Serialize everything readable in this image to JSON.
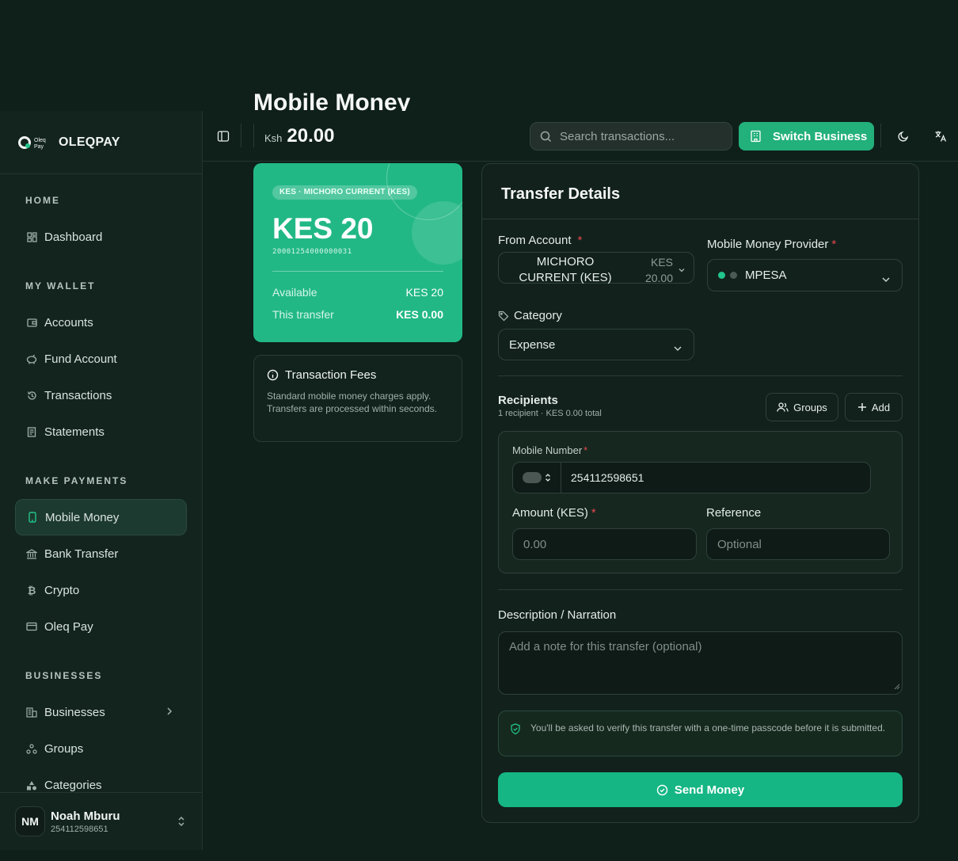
{
  "app": {
    "name": "OLEQPAY",
    "logo_text": "Oleq Pay"
  },
  "page": {
    "title": "Mobile Money"
  },
  "topbar": {
    "currency": "Ksh",
    "balance": "20.00",
    "search_placeholder": "Search transactions...",
    "switch_business_label": "Switch Business"
  },
  "sidebar": {
    "sections": {
      "home": "HOME",
      "wallet": "MY WALLET",
      "payments": "MAKE PAYMENTS",
      "businesses": "BUSINESSES"
    },
    "items": {
      "dashboard": "Dashboard",
      "accounts": "Accounts",
      "fund_account": "Fund Account",
      "transactions": "Transactions",
      "statements": "Statements",
      "mobile_money": "Mobile Money",
      "bank_transfer": "Bank Transfer",
      "crypto": "Crypto",
      "oleq_pay": "Oleq Pay",
      "businesses": "Businesses",
      "groups": "Groups",
      "categories": "Categories"
    },
    "active_item": "mobile_money",
    "user": {
      "initials": "NM",
      "name": "Noah Mburu",
      "phone": "254112598651"
    }
  },
  "account_card": {
    "chip": "KES · MICHORO CURRENT (KES)",
    "balance": "KES 20",
    "account_number": "20001254000000031",
    "available_label": "Available",
    "available_value": "KES 20",
    "this_transfer_label": "This transfer",
    "this_transfer_value": "KES 0.00"
  },
  "fees": {
    "title": "Transaction Fees",
    "text": "Standard mobile money charges apply. Transfers are processed within seconds."
  },
  "transfer": {
    "title": "Transfer Details",
    "from_account_label": "From Account",
    "from_account_name": "MICHORO CURRENT (KES)",
    "from_account_balance": "KES 20.00",
    "provider_label": "Mobile Money Provider",
    "provider_value": "MPESA",
    "category_label": "Category",
    "category_value": "Expense",
    "recipients_label": "Recipients",
    "recipients_summary": "1 recipient · KES 0.00 total",
    "groups_button": "Groups",
    "add_button": "Add",
    "mobile_number_label": "Mobile Number",
    "mobile_number_value": "254112598651",
    "amount_label": "Amount (KES)",
    "amount_placeholder": "0.00",
    "reference_label": "Reference",
    "reference_placeholder": "Optional",
    "description_label": "Description / Narration",
    "description_placeholder": "Add a note for this transfer (optional)",
    "otp_notice": "You'll be asked to verify this transfer with a one-time passcode before it is submitted.",
    "send_button": "Send Money"
  },
  "colors": {
    "accent": "#22b886",
    "background": "#0f1f1a",
    "sidebar": "#13241f",
    "required": "#e5484d"
  }
}
